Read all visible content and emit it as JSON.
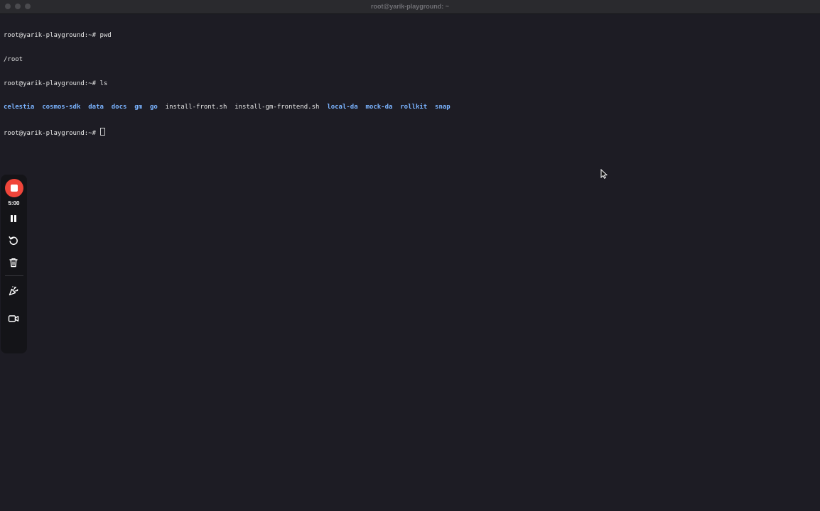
{
  "window": {
    "title": "root@yarik-playground: ~"
  },
  "terminal": {
    "lines": [
      {
        "prompt": "root@yarik-playground:~# ",
        "command": "pwd"
      },
      {
        "output": "/root"
      },
      {
        "prompt": "root@yarik-playground:~# ",
        "command": "ls"
      },
      {
        "listing": true
      },
      {
        "prompt": "root@yarik-playground:~# ",
        "command": ""
      }
    ],
    "prompt1": "root@yarik-playground:~# ",
    "command1": "pwd",
    "output1": "/root",
    "prompt2": "root@yarik-playground:~# ",
    "command2": "ls",
    "prompt3": "root@yarik-playground:~# ",
    "listing": [
      {
        "name": "celestia",
        "kind": "dir"
      },
      {
        "name": "cosmos-sdk",
        "kind": "dir"
      },
      {
        "name": "data",
        "kind": "dir"
      },
      {
        "name": "docs",
        "kind": "dir"
      },
      {
        "name": "gm",
        "kind": "dir"
      },
      {
        "name": "go",
        "kind": "dir"
      },
      {
        "name": "install-front.sh",
        "kind": "file"
      },
      {
        "name": "install-gm-frontend.sh",
        "kind": "file"
      },
      {
        "name": "local-da",
        "kind": "dir"
      },
      {
        "name": "mock-da",
        "kind": "dir"
      },
      {
        "name": "rollkit",
        "kind": "dir"
      },
      {
        "name": "snap",
        "kind": "dir"
      }
    ],
    "colors": {
      "background": "#1d1c24",
      "text": "#e4e4e4",
      "directory": "#7ab3ff"
    }
  },
  "recorder": {
    "timer": "5:00",
    "tools": [
      {
        "name": "stop",
        "icon": "stop-icon"
      },
      {
        "name": "pause",
        "icon": "pause-icon"
      },
      {
        "name": "restart",
        "icon": "restart-icon"
      },
      {
        "name": "delete",
        "icon": "trash-icon"
      },
      {
        "name": "effects",
        "icon": "confetti-icon"
      },
      {
        "name": "camera",
        "icon": "camera-icon"
      }
    ],
    "accent": "#f0453a"
  }
}
